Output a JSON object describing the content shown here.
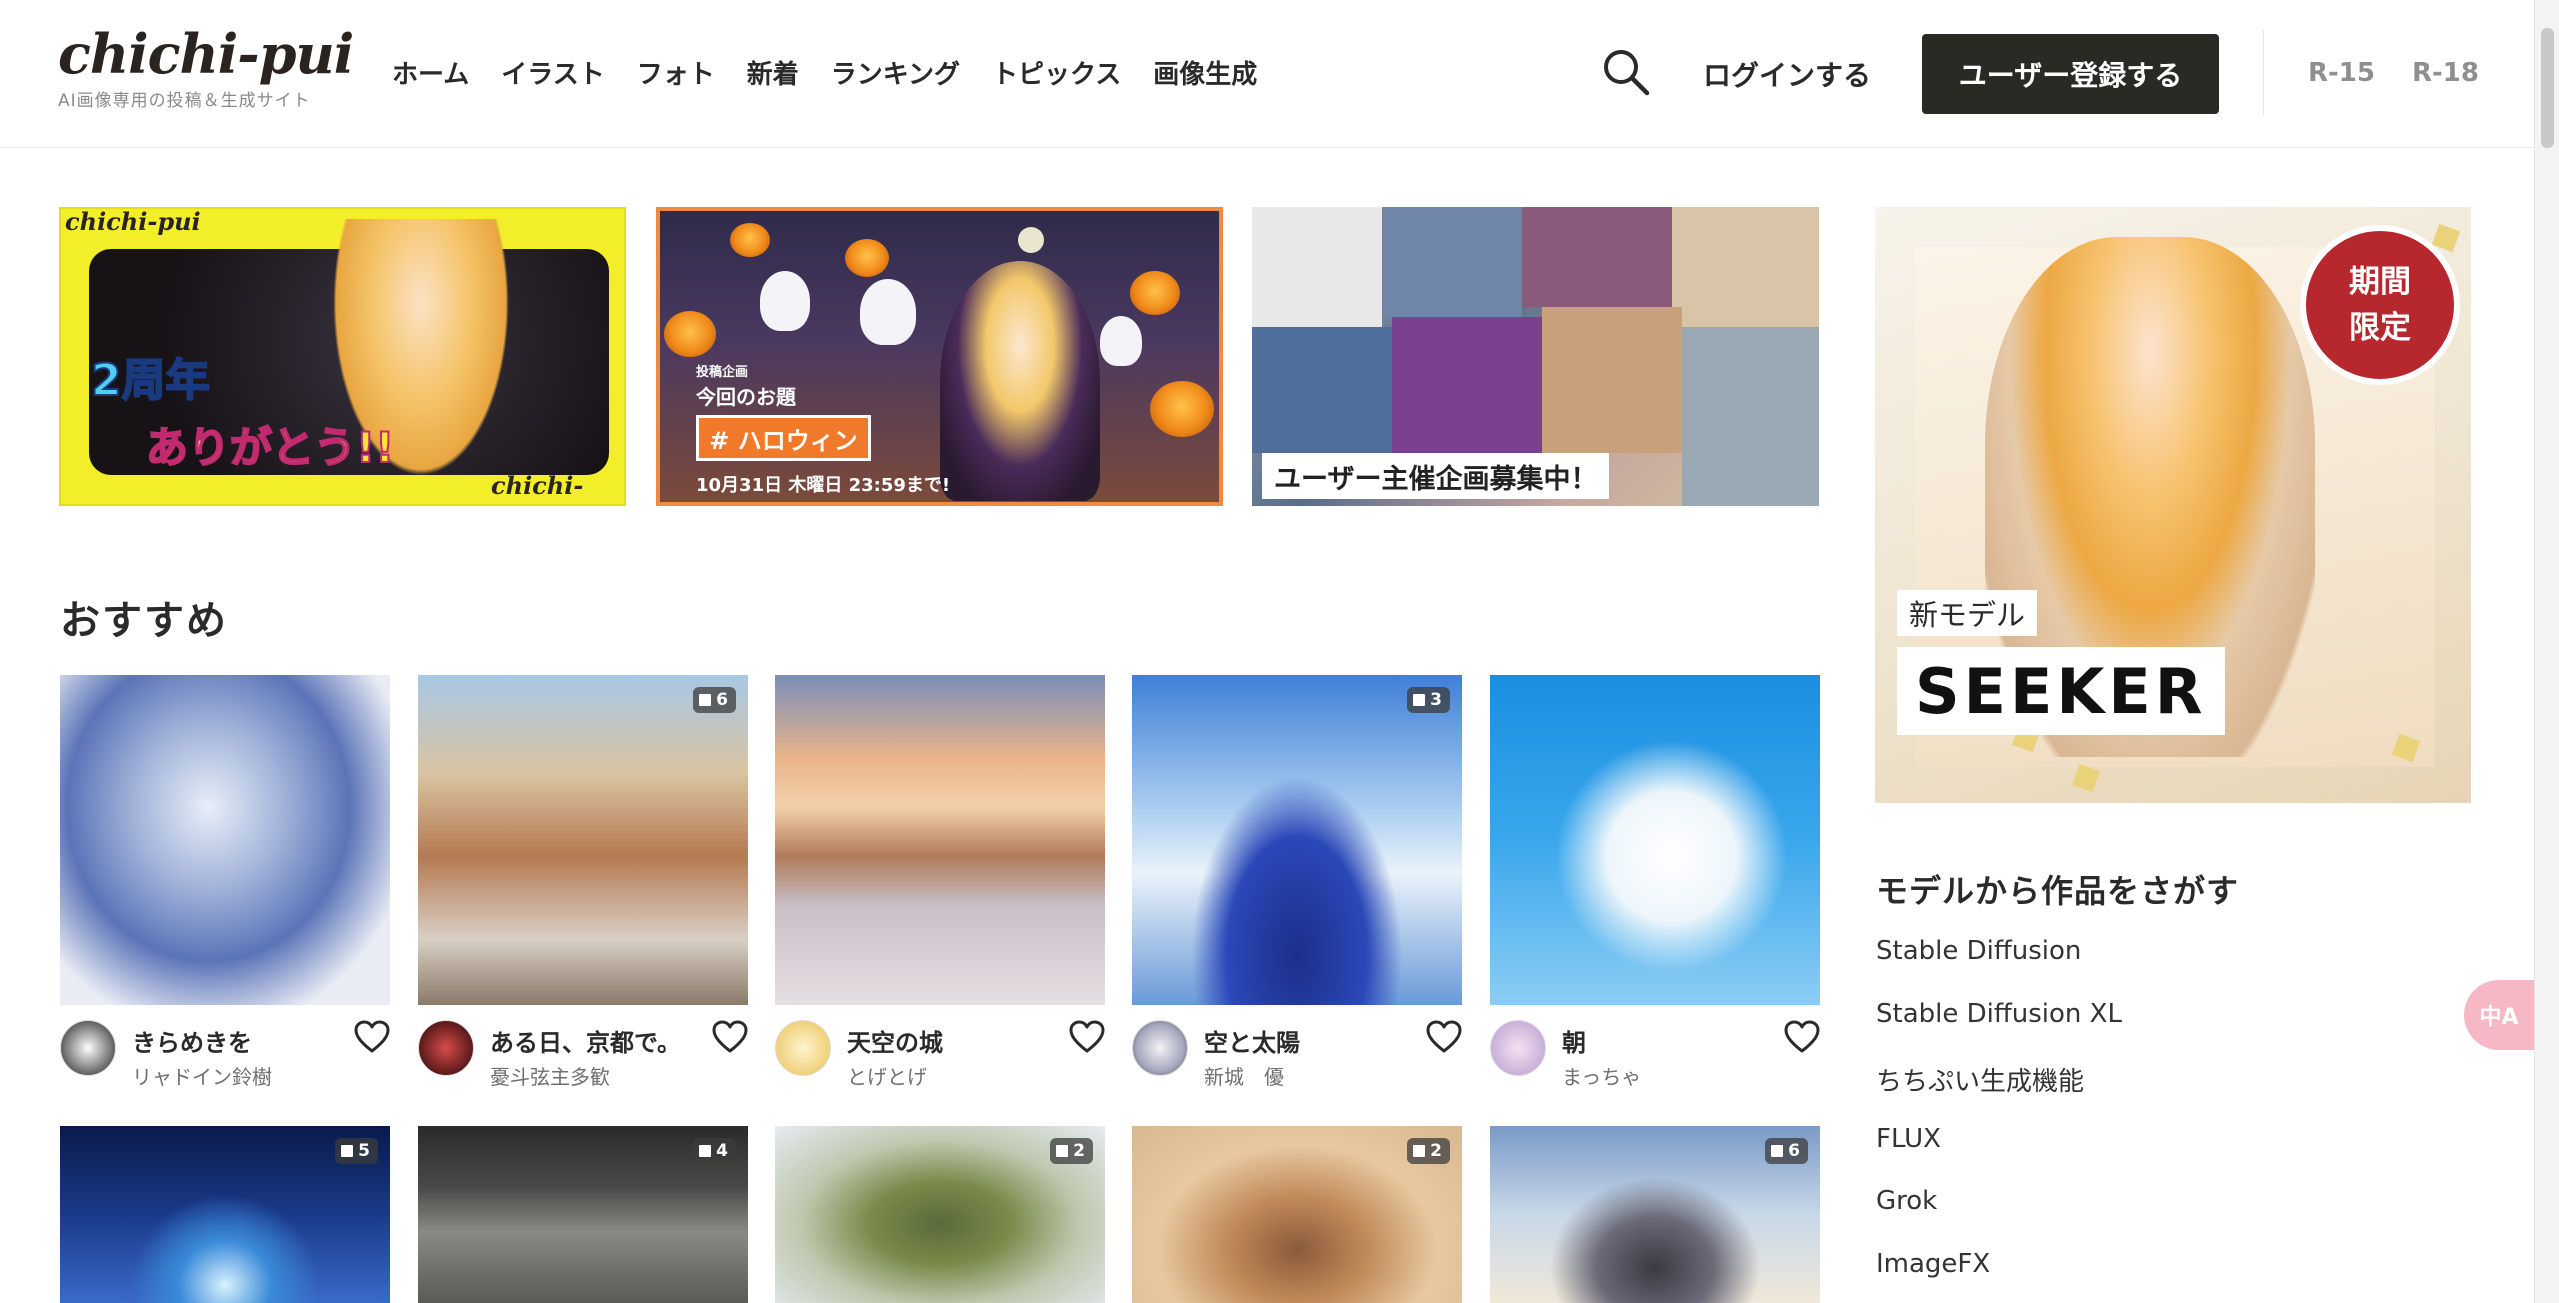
{
  "header": {
    "logo_text": "chichi-pui",
    "logo_subtitle": "AI画像専用の投稿＆生成サイト",
    "nav": [
      "ホーム",
      "イラスト",
      "フォト",
      "新着",
      "ランキング",
      "トピックス",
      "画像生成"
    ],
    "login_label": "ログインする",
    "register_label": "ユーザー登録する",
    "ratings": [
      "R-15",
      "R-18"
    ]
  },
  "banners": {
    "anniversary": {
      "logo": "chichi-pui",
      "line1": "2周年",
      "line2": "ありがとう!!"
    },
    "halloween": {
      "small_label": "投稿企画",
      "title": "今回のお題",
      "tag": "# ハロウィン",
      "deadline": "10月31日 木曜日 23:59まで!"
    },
    "user_contest": {
      "caption": "ユーザー主催企画募集中！"
    }
  },
  "section_title": "おすすめ",
  "cards": [
    {
      "title": "きらめきを",
      "author": "リャドイン鈴樹",
      "count": ""
    },
    {
      "title": "ある日、京都で。",
      "author": "憂斗弦主多歓",
      "count": "6"
    },
    {
      "title": "天空の城",
      "author": "とげとげ",
      "count": ""
    },
    {
      "title": "空と太陽",
      "author": "新城　優",
      "count": "3"
    },
    {
      "title": "朝",
      "author": "まっちゃ",
      "count": ""
    },
    {
      "title": "",
      "author": "",
      "count": "5"
    },
    {
      "title": "",
      "author": "",
      "count": "4"
    },
    {
      "title": "",
      "author": "",
      "count": "2"
    },
    {
      "title": "",
      "author": "",
      "count": "2"
    },
    {
      "title": "",
      "author": "",
      "count": "6"
    }
  ],
  "promo": {
    "stamp_line1": "期間",
    "stamp_line2": "限定",
    "new_label": "新モデル",
    "model_name": "SEEKER"
  },
  "sidebar": {
    "title": "モデルから作品をさがす",
    "models": [
      "Stable Diffusion",
      "Stable Diffusion XL",
      "ちちぷい生成機能",
      "FLUX",
      "Grok",
      "ImageFX"
    ]
  },
  "translate_label": "中A",
  "icons": {
    "search": "search-icon",
    "heart": "heart-icon",
    "multi": "multi-image-icon"
  },
  "colors": {
    "primary": "#2b2924",
    "halloween_accent": "#f07a2a",
    "stamp": "#b7282e"
  }
}
